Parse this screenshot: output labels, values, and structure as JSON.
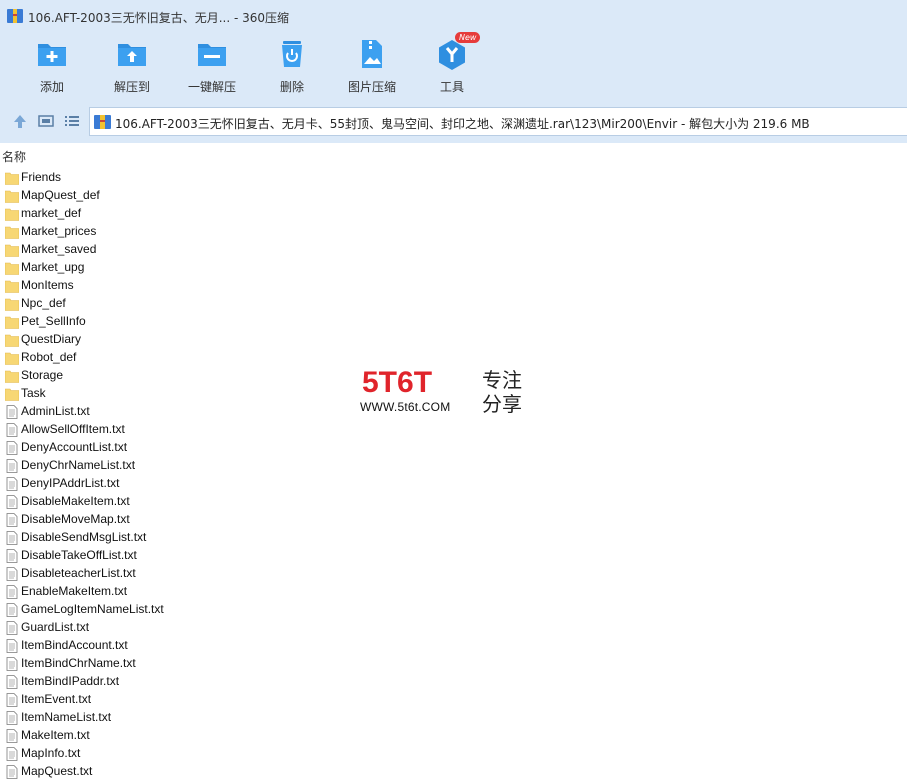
{
  "window": {
    "title": "106.AFT-2003三无怀旧复古、无月... - 360压缩"
  },
  "toolbar": {
    "items": [
      {
        "label": "添加",
        "icon": "add-archive-icon"
      },
      {
        "label": "解压到",
        "icon": "extract-to-icon"
      },
      {
        "label": "一键解压",
        "icon": "one-click-extract-icon"
      },
      {
        "label": "删除",
        "icon": "delete-icon"
      },
      {
        "label": "图片压缩",
        "icon": "image-compress-icon"
      },
      {
        "label": "工具",
        "icon": "tools-icon",
        "badge": "New"
      }
    ]
  },
  "address": {
    "path": "106.AFT-2003三无怀旧复古、无月卡、55封顶、鬼马空间、封印之地、深渊遗址.rar\\123\\Mir200\\Envir - 解包大小为 219.6 MB"
  },
  "columns": {
    "name": "名称"
  },
  "files": [
    {
      "name": "Friends",
      "type": "folder"
    },
    {
      "name": "MapQuest_def",
      "type": "folder"
    },
    {
      "name": "market_def",
      "type": "folder"
    },
    {
      "name": "Market_prices",
      "type": "folder"
    },
    {
      "name": "Market_saved",
      "type": "folder"
    },
    {
      "name": "Market_upg",
      "type": "folder"
    },
    {
      "name": "MonItems",
      "type": "folder"
    },
    {
      "name": "Npc_def",
      "type": "folder"
    },
    {
      "name": "Pet_SellInfo",
      "type": "folder"
    },
    {
      "name": "QuestDiary",
      "type": "folder"
    },
    {
      "name": "Robot_def",
      "type": "folder"
    },
    {
      "name": "Storage",
      "type": "folder"
    },
    {
      "name": "Task",
      "type": "folder"
    },
    {
      "name": "AdminList.txt",
      "type": "file"
    },
    {
      "name": "AllowSellOffItem.txt",
      "type": "file"
    },
    {
      "name": "DenyAccountList.txt",
      "type": "file"
    },
    {
      "name": "DenyChrNameList.txt",
      "type": "file"
    },
    {
      "name": "DenyIPAddrList.txt",
      "type": "file"
    },
    {
      "name": "DisableMakeItem.txt",
      "type": "file"
    },
    {
      "name": "DisableMoveMap.txt",
      "type": "file"
    },
    {
      "name": "DisableSendMsgList.txt",
      "type": "file"
    },
    {
      "name": "DisableTakeOffList.txt",
      "type": "file"
    },
    {
      "name": "DisableteacherList.txt",
      "type": "file"
    },
    {
      "name": "EnableMakeItem.txt",
      "type": "file"
    },
    {
      "name": "GameLogItemNameList.txt",
      "type": "file"
    },
    {
      "name": "GuardList.txt",
      "type": "file"
    },
    {
      "name": "ItemBindAccount.txt",
      "type": "file"
    },
    {
      "name": "ItemBindChrName.txt",
      "type": "file"
    },
    {
      "name": "ItemBindIPaddr.txt",
      "type": "file"
    },
    {
      "name": "ItemEvent.txt",
      "type": "file"
    },
    {
      "name": "ItemNameList.txt",
      "type": "file"
    },
    {
      "name": "MakeItem.txt",
      "type": "file"
    },
    {
      "name": "MapInfo.txt",
      "type": "file"
    },
    {
      "name": "MapQuest.txt",
      "type": "file"
    }
  ],
  "watermark": {
    "logo": "5T6T",
    "url": "WWW.5t6t.COM",
    "slogan": "专注分享"
  },
  "colors": {
    "chrome_bg": "#dbe9f8",
    "accent_blue": "#1e88d8",
    "folder_yellow": "#f7d774",
    "watermark_red": "#e0242b"
  }
}
